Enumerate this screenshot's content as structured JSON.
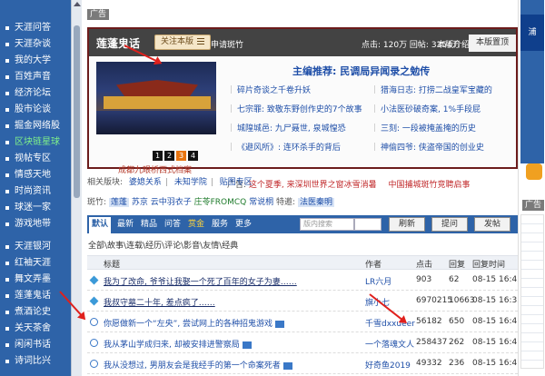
{
  "sidebar": {
    "items": [
      "天涯问答",
      "天涯杂谈",
      "我的大学",
      "百姓声音",
      "经济论坛",
      "股市论谈",
      "掘金网络股",
      "区块链星球",
      "视帖专区",
      "情感天地",
      "时尚资讯",
      "球迷一家",
      "游戏地带"
    ],
    "active_index": 7,
    "items2": [
      "天涯银河",
      "红袖天涯",
      "舞文弄墨",
      "莲蓬鬼话",
      "煮酒论史",
      "关天茶舍",
      "闲闲书话",
      "诗词比兴"
    ]
  },
  "ad_label": "广告",
  "board": {
    "title": "莲蓬鬼话",
    "follow_label": "关注本版",
    "apply_mod": "申请斑竹",
    "stats": "点击: 120万 回帖: 3354万",
    "rules": "本版介绍",
    "bz_label": "本版置顶",
    "photo_caption": "成都九眼桥西式档案",
    "photo_pages": [
      "1",
      "2",
      "3",
      "4"
    ],
    "photo_current": 2,
    "rec_title": "主编推荐: 民调局异闻录之勉传",
    "rec_links": [
      "碎片奇谈之千卷升妖",
      "猎海日志: 打捞二战皇军宝藏的",
      "七宗罪: 致敬东野创作史的7个故事",
      "小法医砂破奇案, 1%手段屁",
      "城隍城邑: 九尸聂世, 泉城惶恐",
      "三刻: 一段被掩盖掩的历史",
      "《避风所》: 连环杀手的背后",
      "神偷四爷: 侠盗帝国的创业史"
    ],
    "board_ad_label": "广告:",
    "board_ad_1": "这个夏季, 来深圳世界之窗冰雪消暑",
    "board_ad_2": "中国捕城斑竹竞聘启事"
  },
  "related": {
    "label": "相关版块:",
    "links": [
      "婆媳关系",
      "未知学院",
      "贴图专区"
    ]
  },
  "sub_boards": {
    "label": "斑竹:",
    "selected": "莲蓬",
    "items": [
      "苏京",
      "云中羽衣子",
      "庄苓FROMCQ",
      "常说桐"
    ],
    "special_label": "特邀:",
    "special": "法医秦明"
  },
  "toolbar": {
    "tabs": [
      "默认",
      "最新",
      "精品",
      "问答",
      "赏金",
      "服务",
      "更多"
    ],
    "active_index": 0,
    "gold_index": 4,
    "search_placeholder": "版内搜索",
    "refresh": "刷新",
    "ask": "提问",
    "post": "发帖"
  },
  "categories": "全部\\故事\\连载\\经历\\评论\\影音\\友情\\经典",
  "list_head": {
    "title": "标题",
    "author": "作者",
    "clicks": "点击",
    "replies": "回复",
    "time": "回复时间"
  },
  "rows": [
    {
      "icon": "diamond-icon",
      "title": "我为了改命, 爷爷让我娶一个死了百年的女子为妻……",
      "author": "LR六月",
      "clicks": "903",
      "replies": "62",
      "time": "08-15 16:43",
      "img": false,
      "dark": true
    },
    {
      "icon": "diamond-icon",
      "title": "我叔守墓二十年, 差点疯了……",
      "author": "旗小七",
      "clicks": "6970215",
      "replies": "10663",
      "time": "08-15 16:35",
      "img": false,
      "dark": true
    },
    {
      "icon": "question-icon",
      "title": "你愿做新一个“左央”, 尝试网上的各种招鬼游戏",
      "author": "千雪dxxueer",
      "clicks": "56182",
      "replies": "650",
      "time": "08-15 16:47",
      "img": true,
      "dark": false
    },
    {
      "icon": "question-icon",
      "title": "我从茅山学成归来, 却被安排进警察局",
      "author": "一个落魂文人",
      "clicks": "258437",
      "replies": "262",
      "time": "08-15 16:47",
      "img": true,
      "dark": false
    },
    {
      "icon": "question-icon",
      "title": "我从没想过, 男朋友会是我经手的第一个命案死者",
      "author": "好奇鱼2019",
      "clicks": "49332",
      "replies": "236",
      "time": "08-15 16:47",
      "img": true,
      "dark": false
    }
  ],
  "right": {
    "ad_label": "广告",
    "pu_label": "浦"
  }
}
